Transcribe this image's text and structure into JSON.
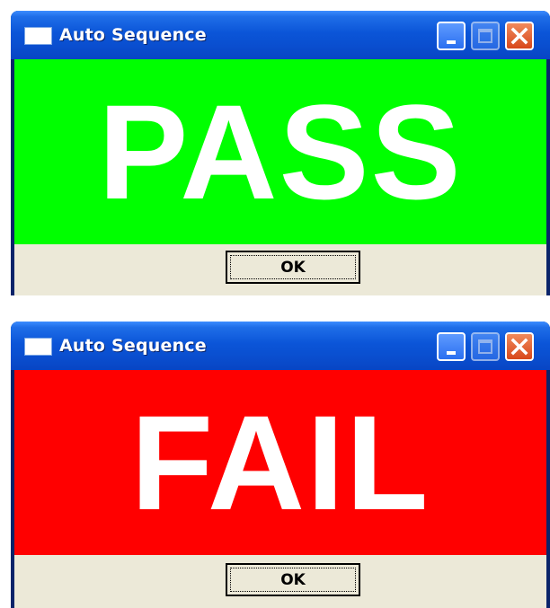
{
  "windows": [
    {
      "title": "Auto Sequence",
      "status_text": "PASS",
      "status_color": "#00ff00",
      "ok_label": "OK"
    },
    {
      "title": "Auto Sequence",
      "status_text": "FAIL",
      "status_color": "#ff0000",
      "ok_label": "OK"
    }
  ],
  "icons": {
    "app": "window-icon",
    "minimize": "minimize-icon",
    "maximize": "maximize-icon",
    "close": "close-icon"
  }
}
